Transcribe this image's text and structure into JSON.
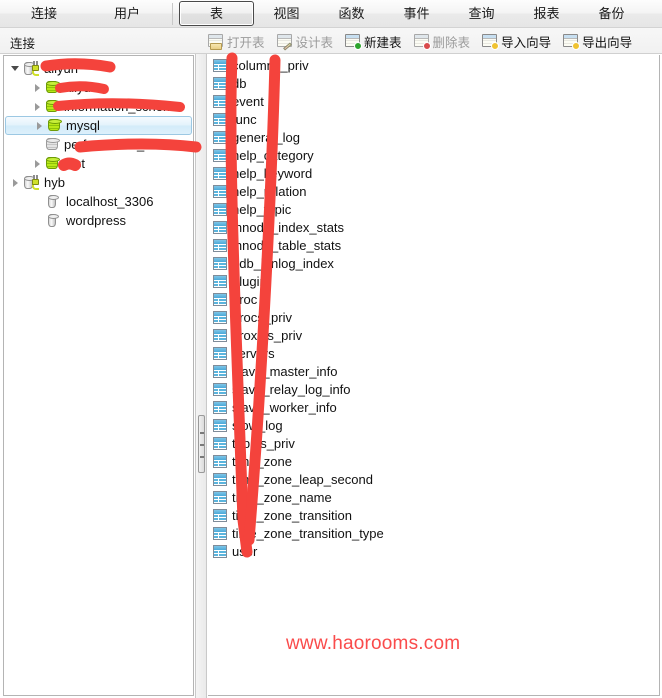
{
  "window": {
    "tabs_left": [
      {
        "label": "连接",
        "name": "tab-connection",
        "selected": false
      },
      {
        "label": "用户",
        "name": "tab-user",
        "selected": false
      }
    ],
    "tabs_right": [
      {
        "label": "表",
        "name": "tab-table",
        "selected": true
      },
      {
        "label": "视图",
        "name": "tab-view",
        "selected": false
      },
      {
        "label": "函数",
        "name": "tab-function",
        "selected": false
      },
      {
        "label": "事件",
        "name": "tab-event",
        "selected": false
      },
      {
        "label": "查询",
        "name": "tab-query",
        "selected": false
      },
      {
        "label": "报表",
        "name": "tab-report",
        "selected": false
      },
      {
        "label": "备份",
        "name": "tab-backup",
        "selected": false
      }
    ]
  },
  "toolbar": {
    "pane_label": "连接",
    "buttons": [
      {
        "label": "打开表",
        "name": "open-table-button",
        "icon": "open-table-icon",
        "enabled": false
      },
      {
        "label": "设计表",
        "name": "design-table-button",
        "icon": "design-table-icon",
        "enabled": false
      },
      {
        "label": "新建表",
        "name": "new-table-button",
        "icon": "new-table-icon",
        "enabled": true
      },
      {
        "label": "删除表",
        "name": "delete-table-button",
        "icon": "delete-table-icon",
        "enabled": false
      },
      {
        "label": "导入向导",
        "name": "import-wizard-button",
        "icon": "import-wizard-icon",
        "enabled": true
      },
      {
        "label": "导出向导",
        "name": "export-wizard-button",
        "icon": "export-wizard-icon",
        "enabled": true
      }
    ]
  },
  "sidebar": {
    "tree": [
      {
        "label": "aliyun",
        "name": "tree-item-connection-aliyun",
        "type": "connection",
        "indent": 0,
        "twisty": "open",
        "icon": "connection-icon",
        "icon_state": "active",
        "selected": false,
        "redacted": true
      },
      {
        "label": "aliyun",
        "name": "tree-item-db-aliyun",
        "type": "database",
        "indent": 1,
        "twisty": "closed",
        "icon": "database-icon",
        "icon_state": "active",
        "selected": false,
        "redacted": true
      },
      {
        "label": "information_schema",
        "name": "tree-item-db-information-schema",
        "type": "database",
        "indent": 1,
        "twisty": "closed",
        "icon": "database-icon",
        "icon_state": "active",
        "selected": false,
        "redacted": true
      },
      {
        "label": "mysql",
        "name": "tree-item-db-mysql",
        "type": "database",
        "indent": 1,
        "twisty": "closed",
        "icon": "database-icon",
        "icon_state": "active",
        "selected": true,
        "redacted": false
      },
      {
        "label": "performance_schema",
        "name": "tree-item-db-performance-schema",
        "type": "database",
        "indent": 1,
        "twisty": "none",
        "icon": "database-icon",
        "icon_state": "inactive",
        "selected": false,
        "redacted": true
      },
      {
        "label": "test",
        "name": "tree-item-db-test",
        "type": "database",
        "indent": 1,
        "twisty": "closed",
        "icon": "database-icon",
        "icon_state": "active",
        "selected": false,
        "redacted": true
      },
      {
        "label": "hyb",
        "name": "tree-item-connection-hyb",
        "type": "connection",
        "indent": 0,
        "twisty": "closed",
        "icon": "connection-icon",
        "icon_state": "active",
        "selected": false,
        "redacted": false
      },
      {
        "label": "localhost_3306",
        "name": "tree-item-connection-localhost-3306",
        "type": "connection",
        "indent": 1,
        "twisty": "none",
        "icon": "connection-icon",
        "icon_state": "plain",
        "selected": false,
        "redacted": false
      },
      {
        "label": "wordpress",
        "name": "tree-item-connection-wordpress",
        "type": "connection",
        "indent": 1,
        "twisty": "none",
        "icon": "connection-icon",
        "icon_state": "plain",
        "selected": false,
        "redacted": false
      }
    ]
  },
  "main": {
    "tables": [
      {
        "label": "columns_priv",
        "name": "table-item-columns-priv"
      },
      {
        "label": "db",
        "name": "table-item-db"
      },
      {
        "label": "event",
        "name": "table-item-event"
      },
      {
        "label": "func",
        "name": "table-item-func"
      },
      {
        "label": "general_log",
        "name": "table-item-general-log"
      },
      {
        "label": "help_category",
        "name": "table-item-help-category"
      },
      {
        "label": "help_keyword",
        "name": "table-item-help-keyword"
      },
      {
        "label": "help_relation",
        "name": "table-item-help-relation"
      },
      {
        "label": "help_topic",
        "name": "table-item-help-topic"
      },
      {
        "label": "innodb_index_stats",
        "name": "table-item-innodb-index-stats"
      },
      {
        "label": "innodb_table_stats",
        "name": "table-item-innodb-table-stats"
      },
      {
        "label": "ndb_binlog_index",
        "name": "table-item-ndb-binlog-index"
      },
      {
        "label": "plugin",
        "name": "table-item-plugin"
      },
      {
        "label": "proc",
        "name": "table-item-proc"
      },
      {
        "label": "procs_priv",
        "name": "table-item-procs-priv"
      },
      {
        "label": "proxies_priv",
        "name": "table-item-proxies-priv"
      },
      {
        "label": "servers",
        "name": "table-item-servers"
      },
      {
        "label": "slave_master_info",
        "name": "table-item-slave-master-info"
      },
      {
        "label": "slave_relay_log_info",
        "name": "table-item-slave-relay-log-info"
      },
      {
        "label": "slave_worker_info",
        "name": "table-item-slave-worker-info"
      },
      {
        "label": "slow_log",
        "name": "table-item-slow-log"
      },
      {
        "label": "tables_priv",
        "name": "table-item-tables-priv"
      },
      {
        "label": "time_zone",
        "name": "table-item-time-zone"
      },
      {
        "label": "time_zone_leap_second",
        "name": "table-item-time-zone-leap-second"
      },
      {
        "label": "time_zone_name",
        "name": "table-item-time-zone-name"
      },
      {
        "label": "time_zone_transition",
        "name": "table-item-time-zone-transition"
      },
      {
        "label": "time_zone_transition_type",
        "name": "table-item-time-zone-transition-type"
      },
      {
        "label": "user",
        "name": "table-item-user"
      }
    ]
  },
  "watermark": {
    "text": "www.haorooms.com"
  },
  "annotation": {
    "color": "#f4433c",
    "description": "hand-drawn red marker strokes redacting sidebar names and a large V/check over the table list"
  }
}
